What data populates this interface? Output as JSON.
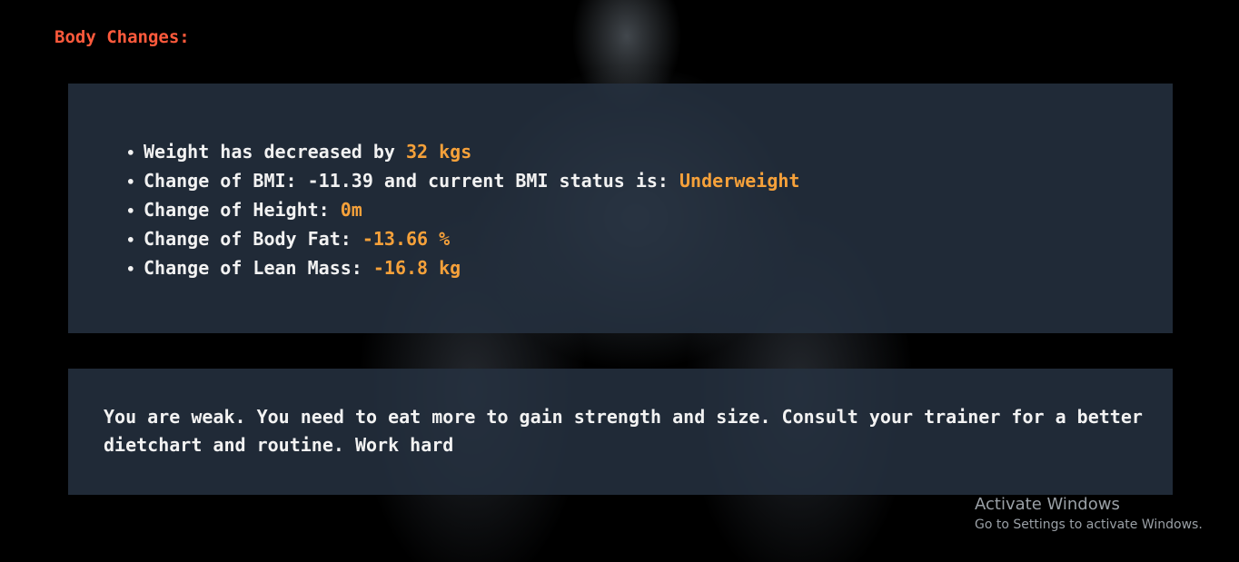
{
  "page": {
    "heading": "Body Changes:"
  },
  "changes": [
    {
      "label": "Weight has decreased by ",
      "value": "32 kgs"
    },
    {
      "label": "Change of BMI: -11.39 and current BMI status is: ",
      "value": "Underweight"
    },
    {
      "label": "Change of Height: ",
      "value": "0m"
    },
    {
      "label": "Change of Body Fat: ",
      "value": "-13.66 %"
    },
    {
      "label": "Change of Lean Mass: ",
      "value": "-16.8 kg"
    }
  ],
  "message": {
    "text": "You are weak. You need to eat more to gain strength and size. Consult your trainer for a better dietchart and routine. Work hard"
  },
  "watermark": {
    "title": "Activate Windows",
    "subtitle": "Go to Settings to activate Windows."
  },
  "colors": {
    "heading": "#ff5a3c",
    "highlight": "#f6a13a",
    "panel": "#253140",
    "text": "#f2f2f2"
  },
  "icons": {
    "bullet": "bullet-icon",
    "background": "athlete-silhouette-image"
  }
}
